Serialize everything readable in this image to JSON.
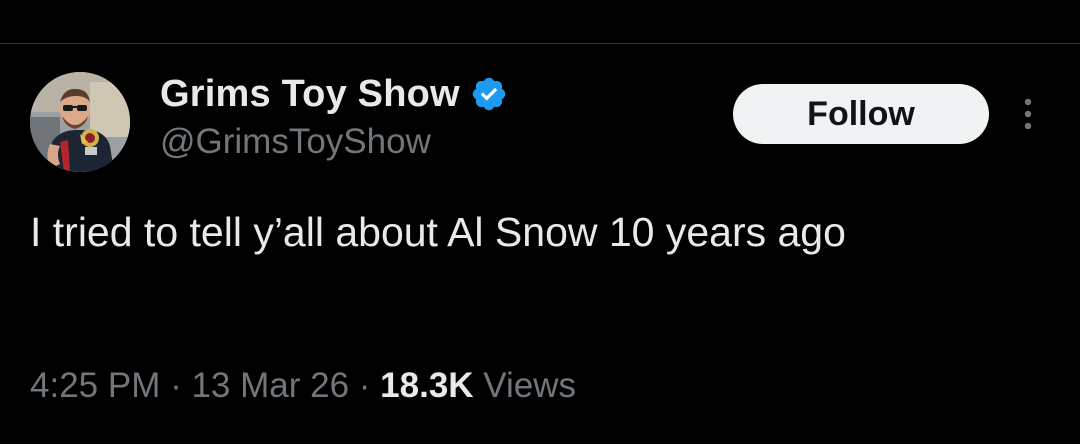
{
  "author": {
    "display_name": "Grims Toy Show",
    "handle": "@GrimsToyShow",
    "verified": true,
    "verified_icon": "verified-badge-icon",
    "avatar_icon": "profile-avatar"
  },
  "actions": {
    "follow_label": "Follow",
    "more_icon": "more-vertical-icon"
  },
  "tweet": {
    "text": "I tried to tell y’all about Al Snow 10 years ago"
  },
  "meta": {
    "time": "4:25 PM",
    "separator": " · ",
    "date": "13 Mar 26",
    "views_count": "18.3K",
    "views_label": " Views"
  },
  "colors": {
    "background": "#000000",
    "primary_text": "#e7e9ea",
    "secondary_text": "#71767b",
    "verified_blue": "#1d9bf0",
    "follow_button_bg": "#eff3f4",
    "divider": "#2f3336"
  }
}
